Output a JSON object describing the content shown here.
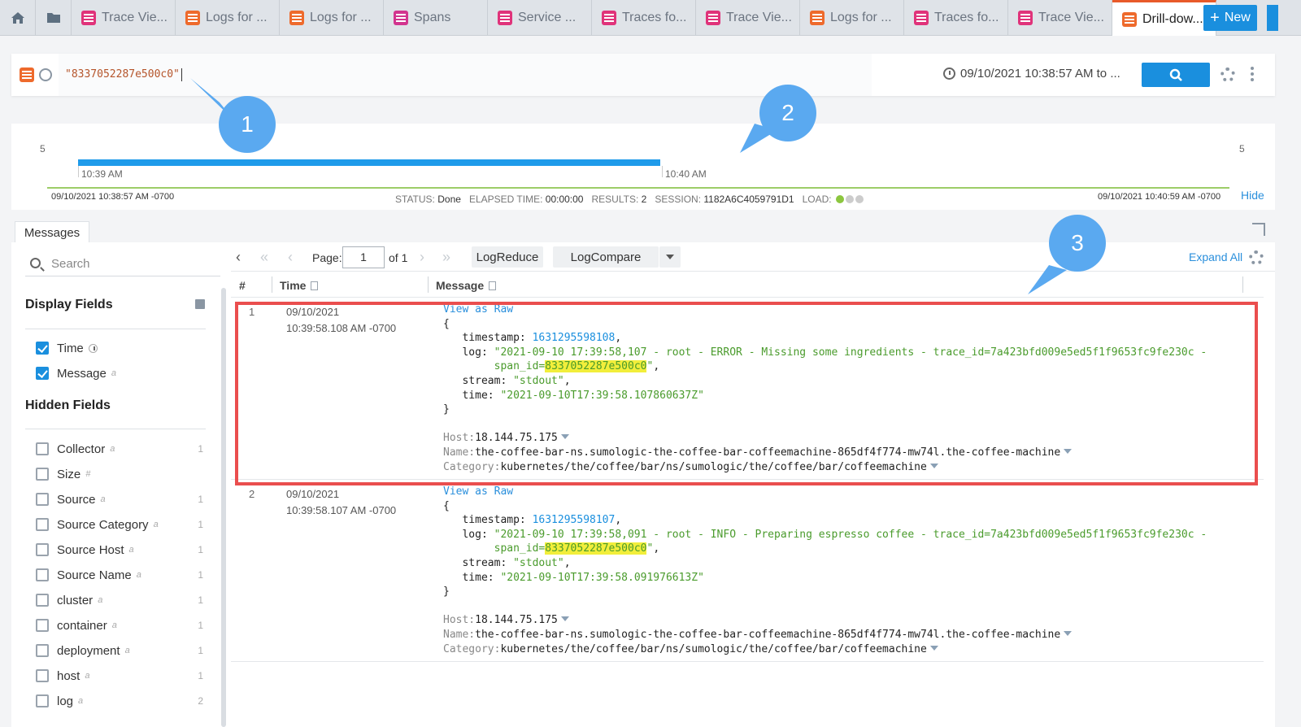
{
  "tabs": [
    {
      "label": "Trace Vie...",
      "kind": "trace"
    },
    {
      "label": "Logs for ...",
      "kind": "log"
    },
    {
      "label": "Logs for ...",
      "kind": "log"
    },
    {
      "label": "Spans",
      "kind": "span"
    },
    {
      "label": "Service ...",
      "kind": "svc"
    },
    {
      "label": "Traces fo...",
      "kind": "trace"
    },
    {
      "label": "Trace Vie...",
      "kind": "trace"
    },
    {
      "label": "Logs for ...",
      "kind": "log"
    },
    {
      "label": "Traces fo...",
      "kind": "trace"
    },
    {
      "label": "Trace Vie...",
      "kind": "trace"
    },
    {
      "label": "Drill-dow...",
      "kind": "log",
      "active": true
    }
  ],
  "new_label": "New",
  "query": {
    "text": "\"8337052287e500c0\"",
    "time_range": "09/10/2021 10:38:57 AM to ..."
  },
  "histogram": {
    "y_left": "5",
    "y_right": "5",
    "tick1": "10:39 AM",
    "tick2": "10:40 AM",
    "start": "09/10/2021 10:38:57 AM -0700",
    "end": "09/10/2021 10:40:59 AM -0700",
    "status_label": "STATUS:",
    "status": "Done",
    "elapsed_label": "ELAPSED TIME:",
    "elapsed": "00:00:00",
    "results_label": "RESULTS:",
    "results": "2",
    "session_label": "SESSION:",
    "session": "1182A6C4059791D1",
    "load_label": "LOAD:",
    "hide": "Hide"
  },
  "callouts": [
    "1",
    "2",
    "3"
  ],
  "messages_tab": "Messages",
  "sidebar": {
    "search_placeholder": "Search",
    "display_title": "Display Fields",
    "hidden_title": "Hidden Fields",
    "display_fields": [
      {
        "name": "Time",
        "type": "",
        "checked": true
      },
      {
        "name": "Message",
        "type": "a",
        "checked": true
      }
    ],
    "hidden_fields": [
      {
        "name": "Collector",
        "type": "a",
        "count": "1"
      },
      {
        "name": "Size",
        "type": "#",
        "count": ""
      },
      {
        "name": "Source",
        "type": "a",
        "count": "1"
      },
      {
        "name": "Source Category",
        "type": "a",
        "count": "1"
      },
      {
        "name": "Source Host",
        "type": "a",
        "count": "1"
      },
      {
        "name": "Source Name",
        "type": "a",
        "count": "1"
      },
      {
        "name": "cluster",
        "type": "a",
        "count": "1"
      },
      {
        "name": "container",
        "type": "a",
        "count": "1"
      },
      {
        "name": "deployment",
        "type": "a",
        "count": "1"
      },
      {
        "name": "host",
        "type": "a",
        "count": "1"
      },
      {
        "name": "log",
        "type": "a",
        "count": "2"
      }
    ]
  },
  "toolbar": {
    "page_label": "Page:",
    "page_value": "1",
    "of_label": "of 1",
    "logreduce": "LogReduce",
    "logcompare": "LogCompare",
    "expand_all": "Expand All"
  },
  "table": {
    "col_num": "#",
    "col_time": "Time",
    "col_message": "Message",
    "view_raw": "View as Raw",
    "rows": [
      {
        "num": "1",
        "date": "09/10/2021",
        "time": "10:39:58.108 AM -0700",
        "timestamp": "1631295598108",
        "log_a": "\"2021-09-10 17:39:58,107 - root - ERROR - Missing some ingredients - trace_id=7a423bfd009e5ed5f1f9653fc9fe230c -",
        "log_b": "span_id=",
        "span_id": "8337052287e500c0",
        "stream": "\"stdout\"",
        "time_val": "\"2021-09-10T17:39:58.107860637Z\"",
        "host": "18.144.75.175",
        "name": "the-coffee-bar-ns.sumologic-the-coffee-bar-coffeemachine-865df4f774-mw74l.the-coffee-machine",
        "category": "kubernetes/the/coffee/bar/ns/sumologic/the/coffee/bar/coffeemachine"
      },
      {
        "num": "2",
        "date": "09/10/2021",
        "time": "10:39:58.107 AM -0700",
        "timestamp": "1631295598107",
        "log_a": "\"2021-09-10 17:39:58,091 - root - INFO - Preparing espresso coffee - trace_id=7a423bfd009e5ed5f1f9653fc9fe230c -",
        "log_b": "span_id=",
        "span_id": "8337052287e500c0",
        "stream": "\"stdout\"",
        "time_val": "\"2021-09-10T17:39:58.091976613Z\"",
        "host": "18.144.75.175",
        "name": "the-coffee-bar-ns.sumologic-the-coffee-bar-coffeemachine-865df4f774-mw74l.the-coffee-machine",
        "category": "kubernetes/the/coffee/bar/ns/sumologic/the/coffee/bar/coffeemachine"
      }
    ]
  }
}
